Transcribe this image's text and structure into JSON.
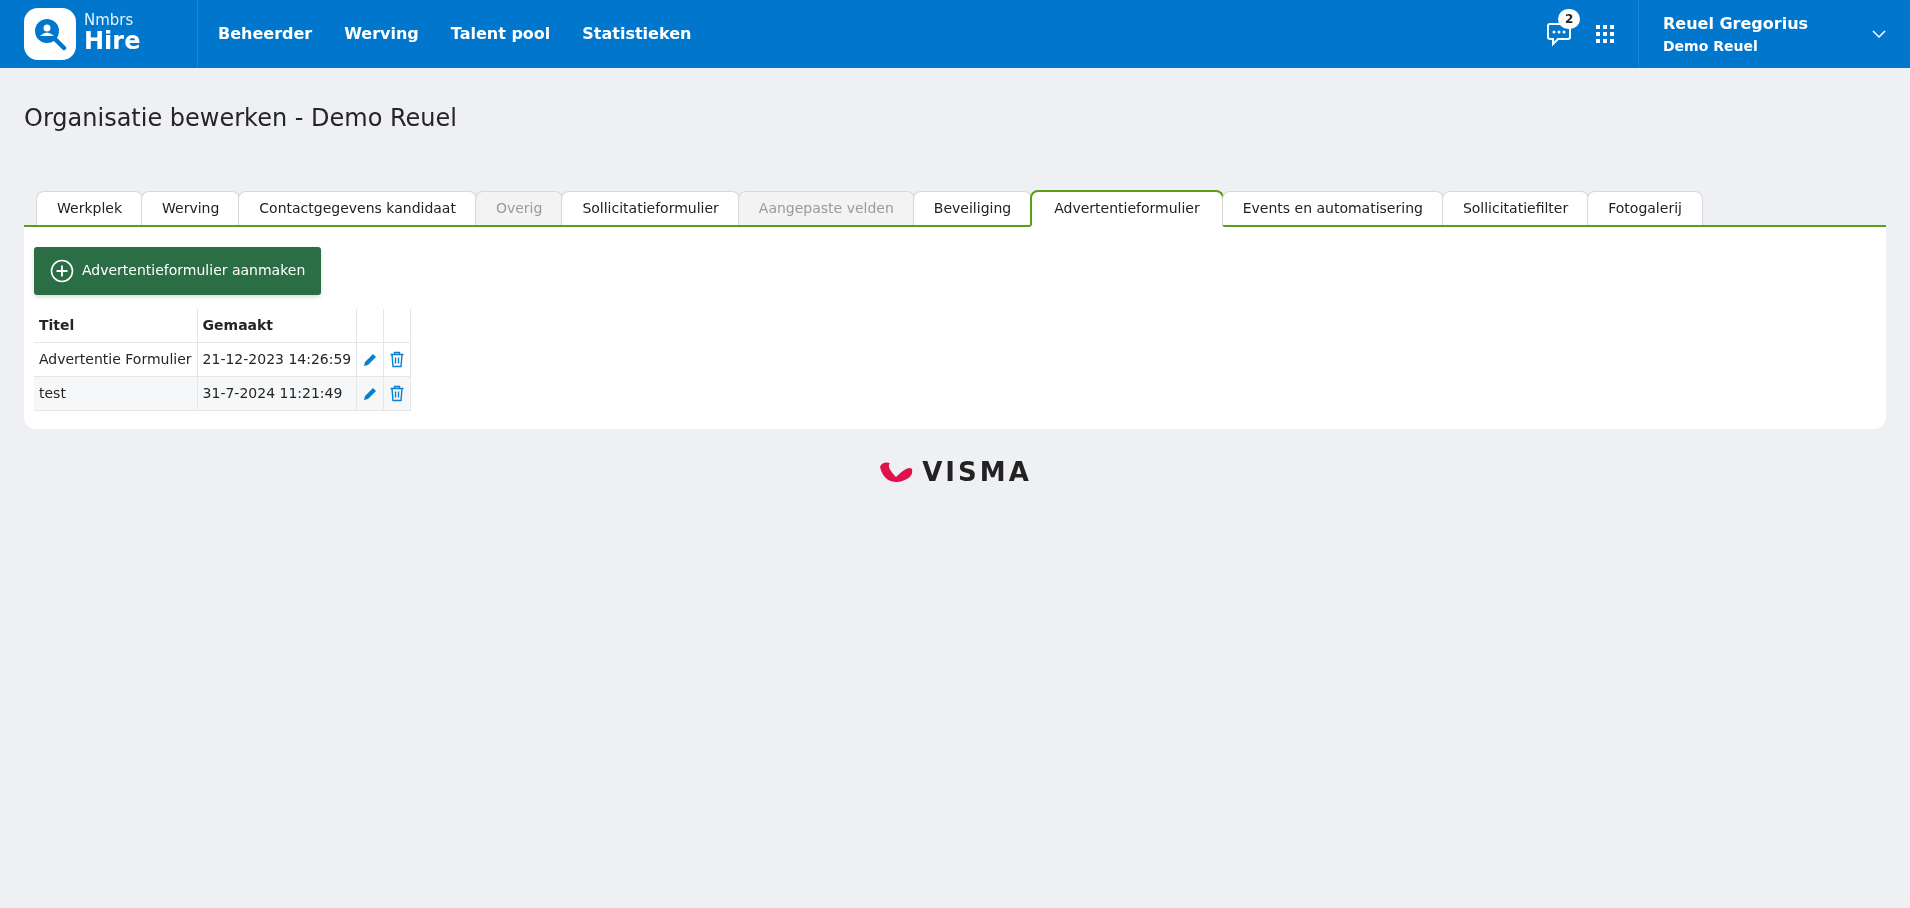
{
  "brand": {
    "small": "Nmbrs",
    "large": "Hire"
  },
  "nav": [
    "Beheerder",
    "Werving",
    "Talent pool",
    "Statistieken"
  ],
  "messages": {
    "badge": "2"
  },
  "user": {
    "name": "Reuel Gregorius",
    "org": "Demo Reuel"
  },
  "page_title": "Organisatie bewerken - Demo Reuel",
  "tabs": [
    {
      "label": "Werkplek",
      "selected": false,
      "disabled": false
    },
    {
      "label": "Werving",
      "selected": false,
      "disabled": false
    },
    {
      "label": "Contactgegevens kandidaat",
      "selected": false,
      "disabled": false
    },
    {
      "label": "Overig",
      "selected": false,
      "disabled": true
    },
    {
      "label": "Sollicitatieformulier",
      "selected": false,
      "disabled": false
    },
    {
      "label": "Aangepaste velden",
      "selected": false,
      "disabled": true
    },
    {
      "label": "Beveiliging",
      "selected": false,
      "disabled": false
    },
    {
      "label": "Advertentieformulier",
      "selected": true,
      "disabled": false
    },
    {
      "label": "Events en automatisering",
      "selected": false,
      "disabled": false
    },
    {
      "label": "Sollicitatiefilter",
      "selected": false,
      "disabled": false
    },
    {
      "label": "Fotogalerij",
      "selected": false,
      "disabled": false
    }
  ],
  "create_button": "Advertentieformulier aanmaken",
  "table": {
    "columns": [
      "Titel",
      "Gemaakt"
    ],
    "rows": [
      {
        "title": "Advertentie Formulier",
        "created": "21-12-2023 14:26:59"
      },
      {
        "title": "test",
        "created": "31-7-2024 11:21:49"
      }
    ]
  },
  "footer_logo": "VISMA"
}
